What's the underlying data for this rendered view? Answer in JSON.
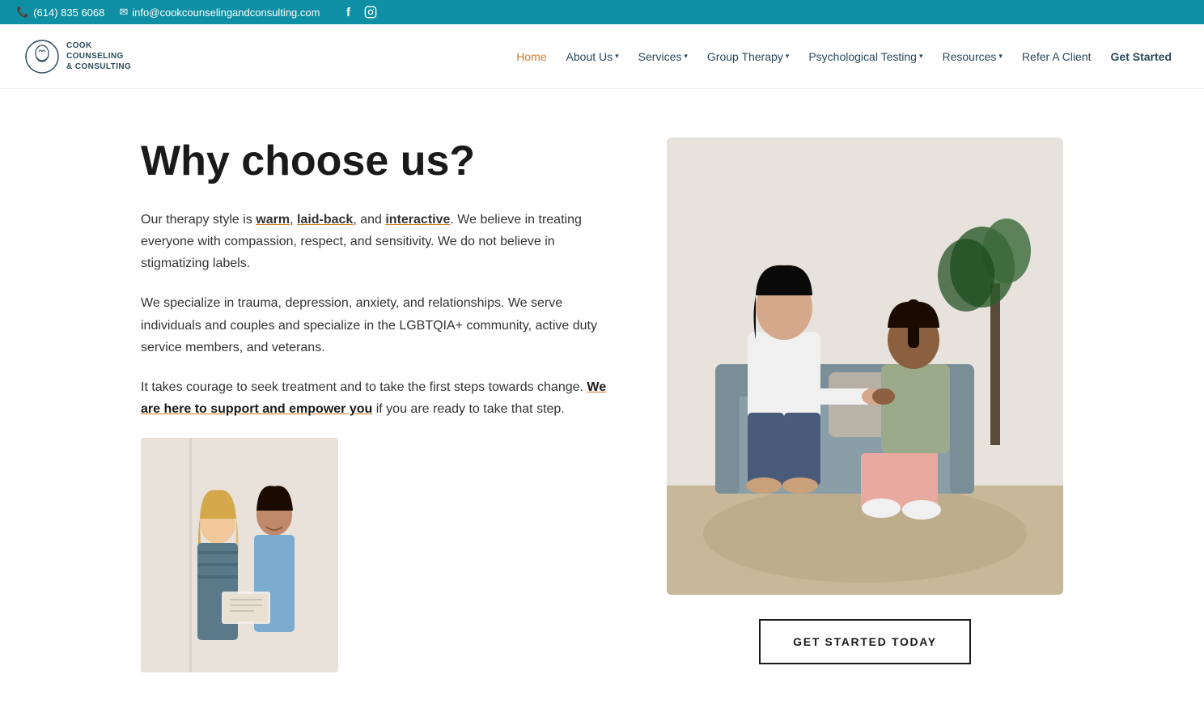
{
  "top_bar": {
    "phone": "(614) 835 6068",
    "email": "info@cookcounselingandconsulting.com",
    "facebook_icon": "f",
    "instagram_icon": "📷"
  },
  "nav": {
    "logo_line1": "COOK",
    "logo_line2": "COUNSELING",
    "logo_line3": "& CONSULTING",
    "links": [
      {
        "label": "Home",
        "active": true,
        "has_dropdown": false
      },
      {
        "label": "About Us",
        "active": false,
        "has_dropdown": true
      },
      {
        "label": "Services",
        "active": false,
        "has_dropdown": true
      },
      {
        "label": "Group Therapy",
        "active": false,
        "has_dropdown": true
      },
      {
        "label": "Psychological Testing",
        "active": false,
        "has_dropdown": true
      },
      {
        "label": "Resources",
        "active": false,
        "has_dropdown": true
      },
      {
        "label": "Refer A Client",
        "active": false,
        "has_dropdown": false
      },
      {
        "label": "Get Started",
        "active": false,
        "has_dropdown": false
      }
    ]
  },
  "main": {
    "heading": "Why choose us?",
    "para1": {
      "prefix": "Our therapy style is ",
      "word1": "warm",
      "sep1": ", ",
      "word2": "laid-back",
      "sep2": ", and ",
      "word3": "interactive",
      "suffix": ". We believe in treating everyone with compassion, respect, and sensitivity. We do not believe in stigmatizing labels."
    },
    "para2": "We specialize in trauma, depression, anxiety, and relationships. We serve individuals and couples and specialize in the LGBTQIA+ community, active duty service members, and veterans.",
    "para3": {
      "prefix": "It takes courage to seek treatment and to take the first steps towards change. ",
      "link_text": "We are here to support and empower you",
      "suffix": " if you are ready to take that step."
    },
    "cta_button": "GET STARTED TODAY"
  }
}
